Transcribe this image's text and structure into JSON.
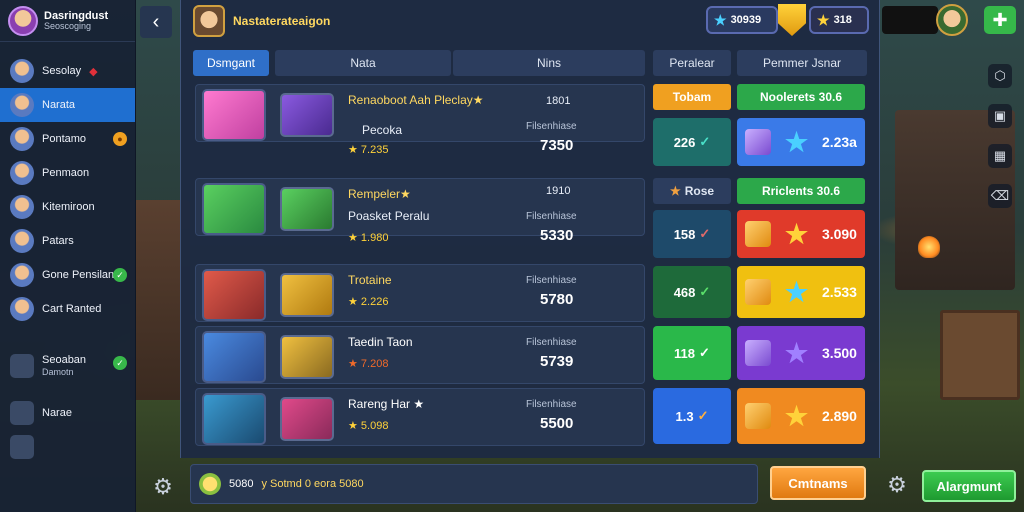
{
  "profile": {
    "name": "Dasringdust",
    "subtitle": "Seoscoging"
  },
  "sidebar": {
    "items": [
      {
        "label": "Sesolay",
        "badge": ""
      },
      {
        "label": "Narata",
        "badge": ""
      },
      {
        "label": "Pontamo",
        "badge": ""
      },
      {
        "label": "Penmaon",
        "badge": ""
      },
      {
        "label": "Kitemiroon",
        "badge": ""
      },
      {
        "label": "Patars",
        "badge": ""
      },
      {
        "label": "Gone Pensilan",
        "badge": ""
      },
      {
        "label": "Cart Ranted",
        "badge": ""
      },
      {
        "label": "Seoaban",
        "sub": "Damotn"
      },
      {
        "label": "Narae"
      }
    ]
  },
  "header": {
    "title": "Nastaterateaigon"
  },
  "currency": {
    "gems": "30939",
    "stars": "318"
  },
  "columns": {
    "tab": "Dsmgant",
    "name": "Nata",
    "price": "Nins",
    "premium": "Peralear",
    "reward": "Pemmer Jsnar"
  },
  "rows": [
    {
      "title": "Renaoboot Aah Pleclay★",
      "subtitle": "Pecoka",
      "rating": "★ 7.235",
      "mid_top": "1801",
      "mid_label": "Filsenhiase",
      "mid_val": "7350",
      "value": "226",
      "reward": "2.23a"
    },
    {
      "title": "Rempeler★",
      "subtitle": "Poasket Peralu",
      "rating": "★ 1.980",
      "mid_top": "1910",
      "mid_label": "Filsenhiase",
      "mid_val": "5330",
      "value": "158",
      "reward": "3.090"
    },
    {
      "title": "Trotaine",
      "subtitle": "",
      "rating": "★ 2.226",
      "mid_top": "",
      "mid_label": "Filsenhiase",
      "mid_val": "5780",
      "value": "468",
      "reward": "2.533"
    },
    {
      "title": "Taedin Taon",
      "subtitle": "",
      "rating": "★ 7.208",
      "mid_top": "",
      "mid_label": "Filsenhiase",
      "mid_val": "5739",
      "value": "118",
      "reward": "3.500"
    },
    {
      "title": "Rareng Har ★",
      "subtitle": "",
      "rating": "★ 5.098",
      "mid_top": "",
      "mid_label": "Filsenhiase",
      "mid_val": "5500",
      "value": "1.3",
      "reward": "2.890"
    }
  ],
  "pills": {
    "top": "Tobam",
    "top2": "Noolerets 30.6",
    "mid": "Rose",
    "mid2": "Rriclents 30.6"
  },
  "footer": {
    "coins": "5080",
    "text": "y Sotmd 0 eora 5080"
  },
  "buttons": {
    "confirm": "Cmtnams",
    "green": "Alargmunt"
  },
  "colors": {
    "accent": "#1f6fd0",
    "gold": "#ffd860"
  }
}
